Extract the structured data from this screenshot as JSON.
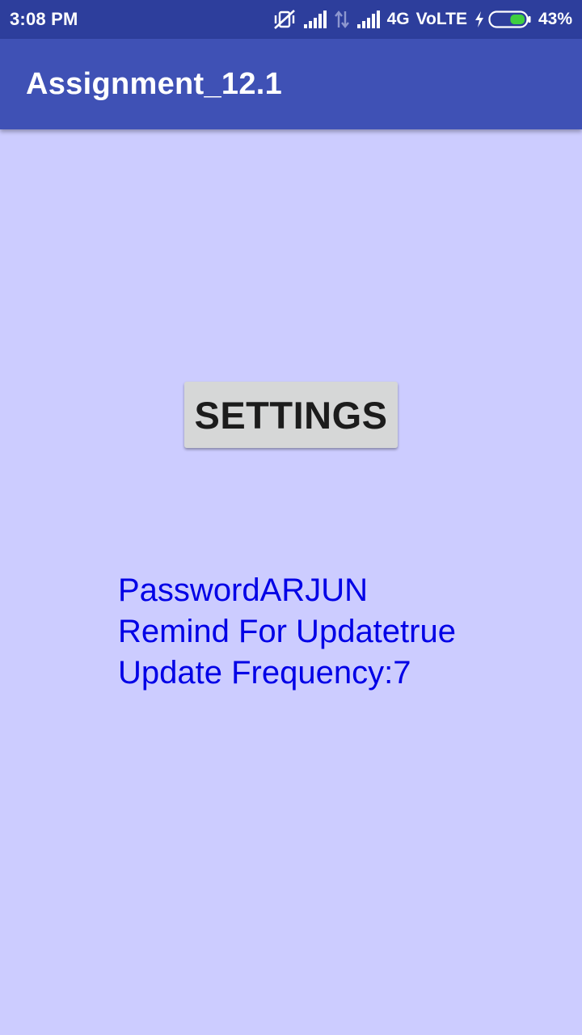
{
  "status_bar": {
    "time": "3:08 PM",
    "network": "4G",
    "volte": "VoLTE",
    "battery": "43%",
    "battery_level": 0.43,
    "icons": [
      "vibrate-off-icon",
      "signal-icon",
      "data-arrows-icon",
      "signal-icon",
      "charging-bolt-icon",
      "battery-icon"
    ]
  },
  "app_bar": {
    "title": "Assignment_12.1",
    "color": "#3f51b5"
  },
  "main": {
    "background": "#ccccff",
    "settings_button_label": "SETTINGS",
    "prefs": {
      "password_line": "PasswordARJUN",
      "remind_line": "Remind For Updatetrue",
      "frequency_line": "Update Frequency:7"
    },
    "text_color": "#0000e6"
  }
}
